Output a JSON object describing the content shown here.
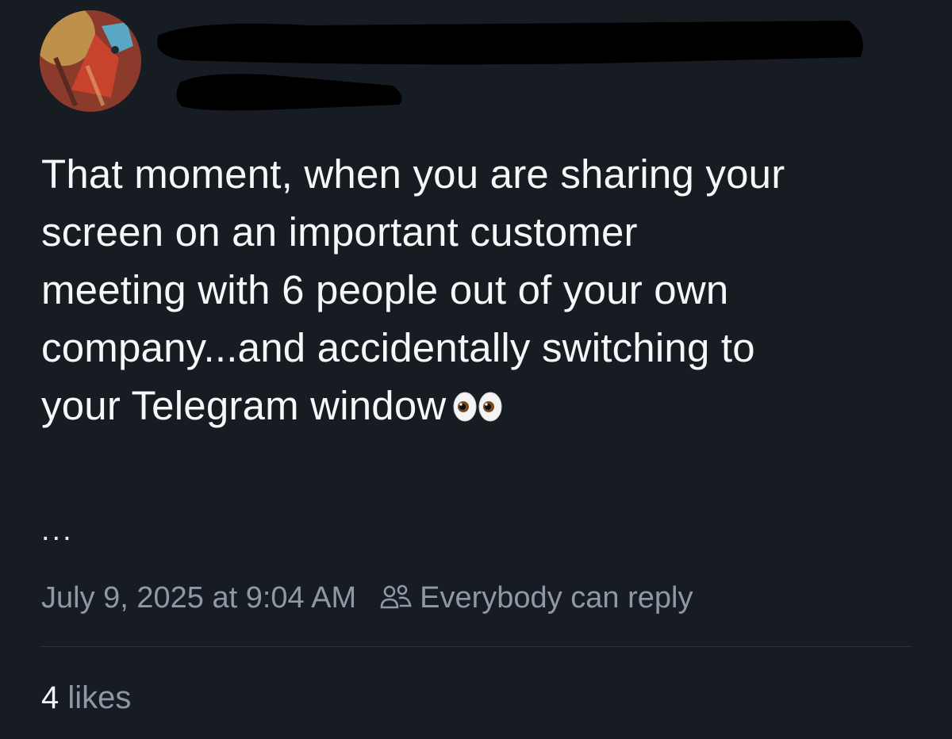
{
  "post": {
    "text": "That moment, when you are sharing your\nscreen on an important customer\nmeeting with 6 people out of your own\ncompany...and accidentally switching to\nyour Telegram window",
    "emoji": "eyes-emoji",
    "more_label": "...",
    "timestamp": "July 9, 2025 at 9:04 AM",
    "reply_setting": "Everybody can reply",
    "reply_icon": "people-icon",
    "likes_count": "4",
    "likes_label": "likes"
  },
  "colors": {
    "background": "#171c23",
    "text": "#f6f7f9",
    "muted": "#8f98a6",
    "divider": "#2a313b",
    "redaction": "#000000"
  }
}
